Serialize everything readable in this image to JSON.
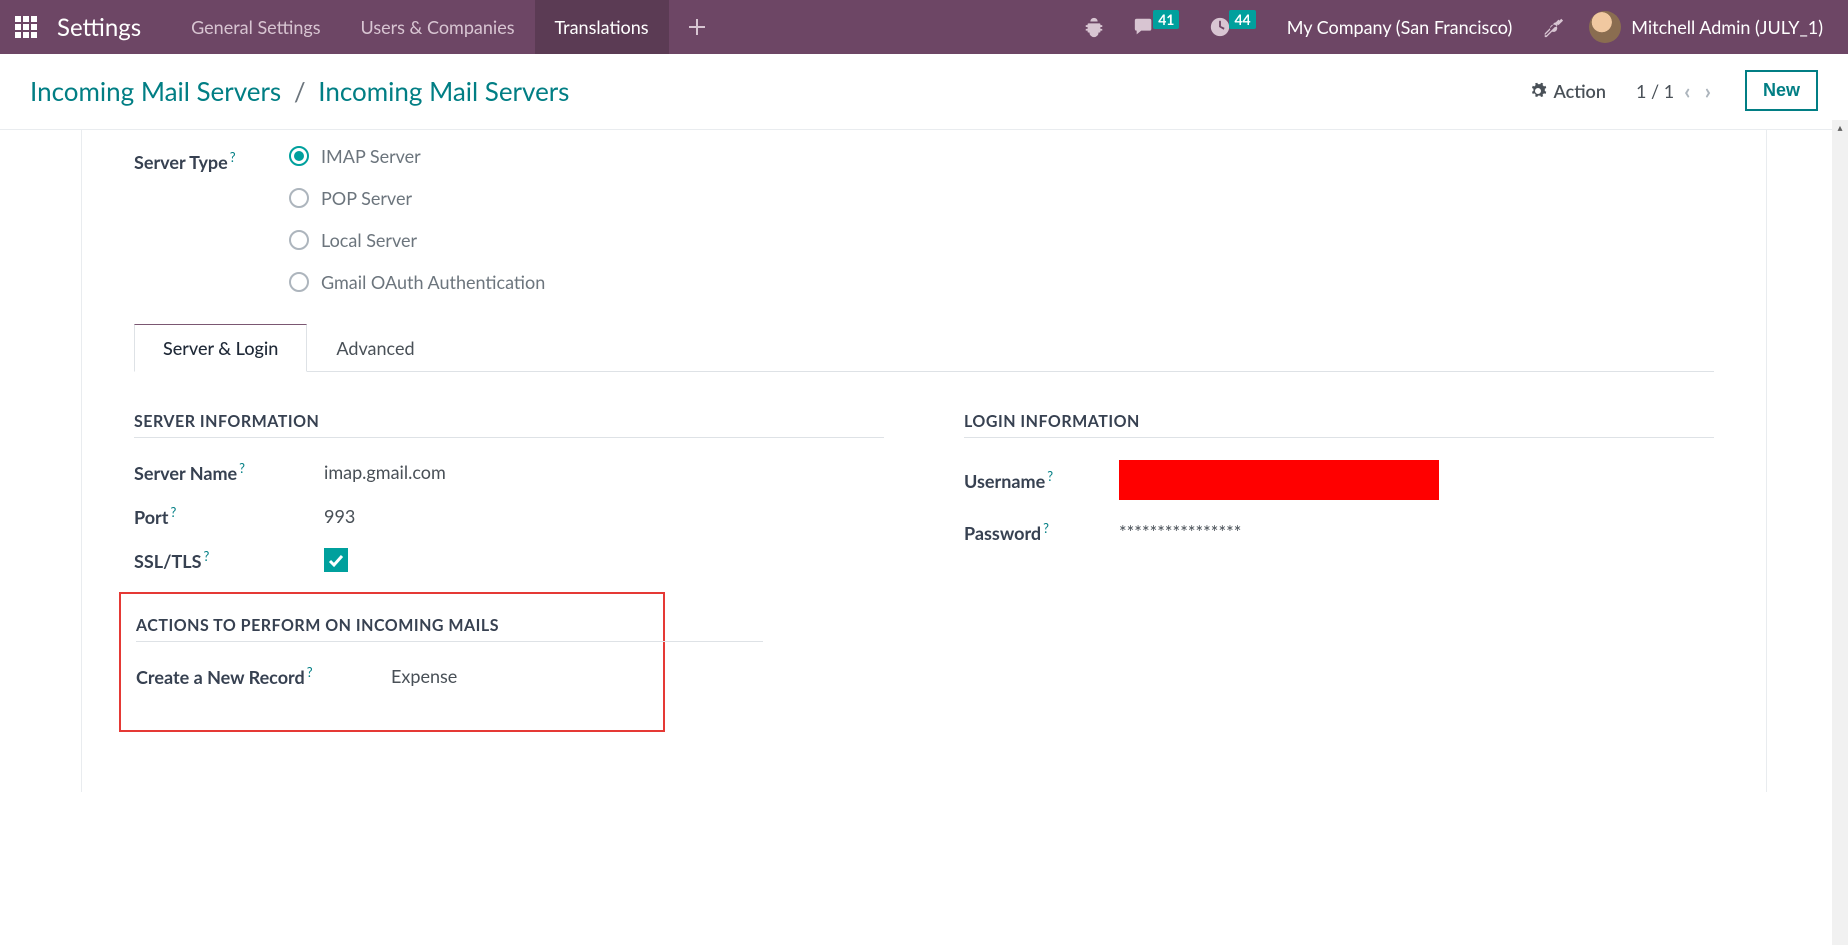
{
  "navbar": {
    "brand": "Settings",
    "menu": [
      "General Settings",
      "Users & Companies",
      "Translations"
    ],
    "active_menu": 2,
    "messages_badge": "41",
    "activities_badge": "44",
    "company": "My Company (San Francisco)",
    "user": "Mitchell Admin (JULY_1)"
  },
  "breadcrumb": {
    "parent": "Incoming Mail Servers",
    "current": "Incoming Mail Servers"
  },
  "control": {
    "action_label": "Action",
    "pager": "1 / 1",
    "new_label": "New"
  },
  "form": {
    "server_type_label": "Server Type",
    "server_type_options": [
      "IMAP Server",
      "POP Server",
      "Local Server",
      "Gmail OAuth Authentication"
    ],
    "server_type_selected": 0,
    "tabs": [
      "Server & Login",
      "Advanced"
    ],
    "active_tab": 0,
    "sections": {
      "server_info": {
        "title": "SERVER INFORMATION",
        "server_name_label": "Server Name",
        "server_name_value": "imap.gmail.com",
        "port_label": "Port",
        "port_value": "993",
        "ssl_label": "SSL/TLS",
        "ssl_checked": true
      },
      "login_info": {
        "title": "LOGIN INFORMATION",
        "username_label": "Username",
        "password_label": "Password",
        "password_value": "****************"
      },
      "actions": {
        "title": "ACTIONS TO PERFORM ON INCOMING MAILS",
        "create_record_label": "Create a New Record",
        "create_record_value": "Expense"
      }
    }
  }
}
